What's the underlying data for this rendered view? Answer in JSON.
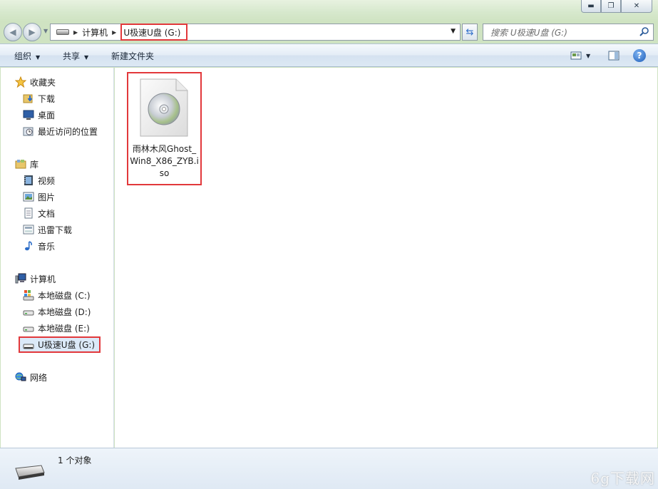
{
  "window": {
    "minimize_glyph": "▬",
    "maximize_glyph": "❐",
    "close_glyph": "✕"
  },
  "nav": {
    "back_glyph": "◀",
    "forward_glyph": "▶",
    "history_glyph": "▼"
  },
  "address": {
    "crumbs": [
      "计算机",
      "U极速U盘 (G:)"
    ],
    "refresh_glyph": "⇆"
  },
  "search": {
    "placeholder": "搜索 U极速U盘 (G:)"
  },
  "toolbar": {
    "organize_label": "组织",
    "share_label": "共享",
    "new_folder_label": "新建文件夹",
    "caret_glyph": "▼",
    "help_glyph": "?"
  },
  "sidebar": {
    "favorites": {
      "label": "收藏夹",
      "items": [
        {
          "label": "下载",
          "icon": "downloads-folder-icon"
        },
        {
          "label": "桌面",
          "icon": "desktop-icon"
        },
        {
          "label": "最近访问的位置",
          "icon": "recent-places-icon"
        }
      ]
    },
    "libraries": {
      "label": "库",
      "items": [
        {
          "label": "视频",
          "icon": "video-library-icon"
        },
        {
          "label": "图片",
          "icon": "picture-library-icon"
        },
        {
          "label": "文档",
          "icon": "document-library-icon"
        },
        {
          "label": "迅雷下载",
          "icon": "thunder-download-icon"
        },
        {
          "label": "音乐",
          "icon": "music-library-icon"
        }
      ]
    },
    "computer": {
      "label": "计算机",
      "items": [
        {
          "label": "本地磁盘 (C:)",
          "icon": "system-drive-icon"
        },
        {
          "label": "本地磁盘 (D:)",
          "icon": "drive-icon"
        },
        {
          "label": "本地磁盘 (E:)",
          "icon": "drive-icon"
        },
        {
          "label": "U极速U盘 (G:)",
          "icon": "usb-drive-icon",
          "selected": true
        }
      ]
    },
    "network": {
      "label": "网络"
    }
  },
  "files": [
    {
      "name": "雨林木风Ghost_Win8_X86_ZYB.iso",
      "icon": "disc-image-icon"
    }
  ],
  "status": {
    "count_text": "1 个对象"
  },
  "watermark": "6g下载网",
  "colors": {
    "highlight_box": "#e2383b",
    "selected_bg": "#dbe9f8",
    "toolbar_bg": "#dce8f4"
  }
}
